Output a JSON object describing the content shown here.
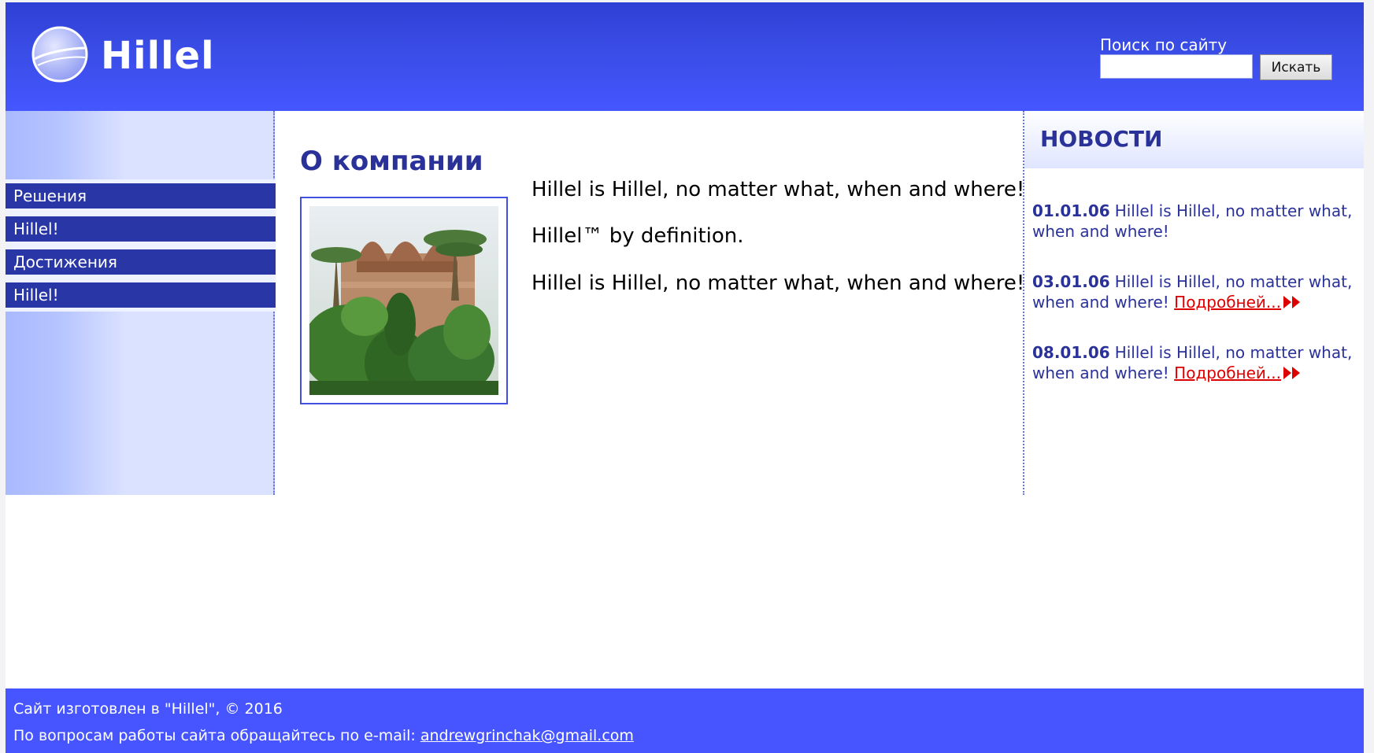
{
  "header": {
    "brand": "Hillel",
    "search_label": "Поиск по сайту",
    "search_value": "",
    "search_placeholder": "",
    "search_button": "Искать"
  },
  "sidebar": {
    "items": [
      {
        "label": "Решения"
      },
      {
        "label": "Hillel!"
      },
      {
        "label": "Достижения"
      },
      {
        "label": "Hillel!"
      }
    ]
  },
  "main": {
    "title": "О компании",
    "paragraphs": [
      "Hillel is Hillel, no matter what, when and where!",
      "Hillel™ by definition.",
      "Hillel is Hillel, no matter what, when and where!"
    ]
  },
  "news": {
    "title": "НОВОСТИ",
    "items": [
      {
        "date": "01.01.06",
        "text": "Hillel is Hillel, no matter what, when and where!",
        "more": ""
      },
      {
        "date": "03.01.06",
        "text": "Hillel is Hillel, no matter what, when and where!",
        "more": "Подробней..."
      },
      {
        "date": "08.01.06",
        "text": "Hillel is Hillel, no matter what, when and where!",
        "more": "Подробней..."
      }
    ]
  },
  "footer": {
    "line1": "Сайт изготовлен в \"Hillel\", © 2016",
    "line2_prefix": "По вопросам работы сайта обращайтесь по e-mail: ",
    "email": "andrewgrinchak@gmail.com"
  },
  "colors": {
    "header_blue": "#3a4de6",
    "nav_dark_blue": "#2936a6",
    "title_blue": "#2a3299",
    "link_red": "#dd0000",
    "footer_blue": "#4655ff"
  }
}
